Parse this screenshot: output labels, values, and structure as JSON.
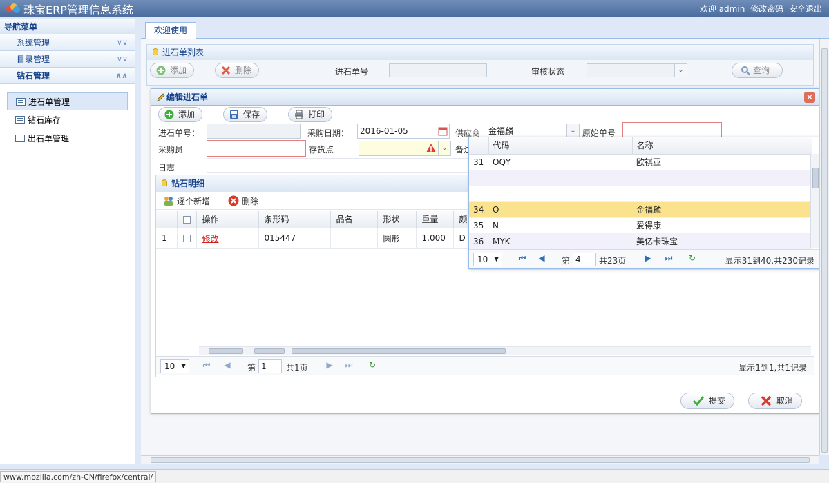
{
  "app": {
    "title": "珠宝ERP管理信息系统",
    "welcome": "欢迎 admin",
    "change_password": "修改密码",
    "logout": "安全退出"
  },
  "nav": {
    "header": "导航菜单",
    "groups": [
      {
        "label": "系统管理",
        "chevron": "double-down"
      },
      {
        "label": "目录管理",
        "chevron": "double-down"
      },
      {
        "label": "钻石管理",
        "chevron": "double-up"
      }
    ],
    "items": [
      {
        "label": "进石单管理",
        "active": true
      },
      {
        "label": "钻石库存",
        "active": false
      },
      {
        "label": "出石单管理",
        "active": false
      }
    ]
  },
  "tabs": [
    {
      "label": "欢迎使用"
    }
  ],
  "list_panel": {
    "title": "进石单列表",
    "add_label": "添加",
    "delete_label": "删除",
    "order_no_label": "进石单号",
    "audit_label": "审核状态",
    "query_label": "查询"
  },
  "dialog": {
    "title": "编辑进石单",
    "add_label": "添加",
    "save_label": "保存",
    "print_label": "打印",
    "fields": {
      "order_no_label": "进石单号：",
      "order_no_value": "",
      "purchase_date_label": "采购日期：",
      "purchase_date_value": "2016-01-05",
      "supplier_label": "供应商",
      "supplier_value": "金福麟",
      "original_no_label": "原始单号",
      "purchaser_label": "采购员",
      "storage_label": "存货点",
      "remark_label": "备注",
      "log_label": "日志"
    },
    "detail": {
      "title": "钻石明细",
      "add_each_label": "逐个新增",
      "delete_label": "删除",
      "columns": [
        "操作",
        "条形码",
        "品名",
        "形状",
        "重量",
        "颜"
      ],
      "rows": [
        {
          "num": "1",
          "action": "修改",
          "barcode": "015447",
          "name": "",
          "shape": "圆形",
          "weight": "1.000",
          "color": "D"
        }
      ],
      "pager": {
        "page_size": "10",
        "page_prefix": "第",
        "page_value": "1",
        "page_total": "共1页",
        "summary": "显示1到1,共1记录"
      }
    },
    "submit_label": "提交",
    "cancel_label": "取消"
  },
  "supplier_dropdown": {
    "col_code": "代码",
    "col_name": "名称",
    "rows": [
      {
        "num": "31",
        "code": "OQY",
        "name": "欧祺亚",
        "state": "normal"
      },
      {
        "num": "",
        "code": "",
        "name": "",
        "state": "alt"
      },
      {
        "num": "",
        "code": "",
        "name": "",
        "state": "normal"
      },
      {
        "num": "34",
        "code": "O",
        "name": "金福麟",
        "state": "selected"
      },
      {
        "num": "35",
        "code": "N",
        "name": "爱得康",
        "state": "normal"
      },
      {
        "num": "36",
        "code": "MYK",
        "name": "美亿卡珠宝",
        "state": "alt"
      }
    ],
    "pager": {
      "page_size": "10",
      "page_prefix": "第",
      "page_value": "4",
      "page_total": "共23页",
      "summary": "显示31到40,共230记录"
    }
  },
  "status_url": "www.mozilla.com/zh-CN/firefox/central/",
  "colors": {
    "brand_bar": "#4c6d9e",
    "panel_border": "#99bbe8",
    "selected_row": "#fbe38e",
    "required_border": "#e08080"
  }
}
